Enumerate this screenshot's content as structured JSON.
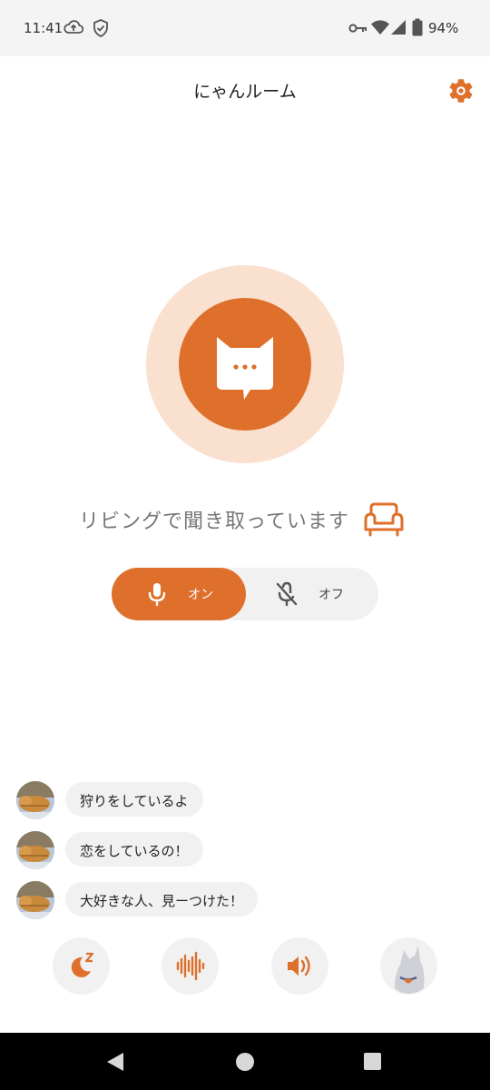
{
  "status_bar": {
    "time": "11:41",
    "battery": "94%",
    "left_icons": [
      "cloud-upload-icon",
      "shield-check-icon"
    ],
    "right_icons": [
      "vpn-key-icon",
      "wifi-icon",
      "cellular-signal-icon",
      "battery-icon"
    ]
  },
  "header": {
    "title": "にゃんルーム",
    "settings_icon": "gear-icon"
  },
  "hero": {
    "icon": "cat-speech-bubble-icon",
    "status_text": "リビングで聞き取っています",
    "room_icon": "sofa-icon"
  },
  "mic_toggle": {
    "on_label": "オン",
    "off_label": "オフ",
    "selected": "on"
  },
  "messages": [
    {
      "text": "狩りをしているよ"
    },
    {
      "text": "恋をしているの！"
    },
    {
      "text": "大好きな人、見ーつけた！"
    }
  ],
  "actions": [
    {
      "icon": "sleep-moon-icon"
    },
    {
      "icon": "sound-wave-icon"
    },
    {
      "icon": "speaker-icon"
    },
    {
      "icon": "cat-profile-icon"
    }
  ],
  "colors": {
    "accent": "#de702c",
    "accent_light": "#fae0cf",
    "chip_bg": "#f1f1f1"
  }
}
